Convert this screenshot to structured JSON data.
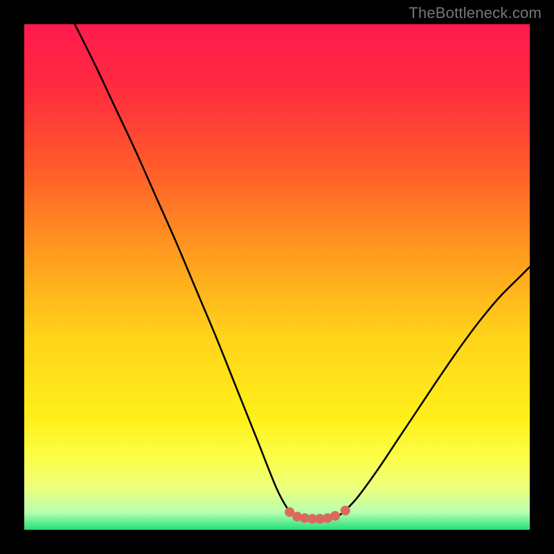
{
  "watermark": "TheBottleneck.com",
  "colors": {
    "frame": "#000000",
    "gradient_stops": [
      {
        "offset": 0.0,
        "color": "#ff1a4d"
      },
      {
        "offset": 0.12,
        "color": "#ff2a3f"
      },
      {
        "offset": 0.28,
        "color": "#ff5a2a"
      },
      {
        "offset": 0.45,
        "color": "#ff9a1f"
      },
      {
        "offset": 0.62,
        "color": "#ffd41a"
      },
      {
        "offset": 0.78,
        "color": "#fff019"
      },
      {
        "offset": 0.86,
        "color": "#fbff4a"
      },
      {
        "offset": 0.92,
        "color": "#eaff80"
      },
      {
        "offset": 0.965,
        "color": "#b9ffb0"
      },
      {
        "offset": 1.0,
        "color": "#22e07a"
      }
    ],
    "curve_stroke": "#000000",
    "marker_stroke": "#da6a5f",
    "marker_fill": "#da6a5f"
  },
  "chart_data": {
    "type": "line",
    "title": "",
    "xlabel": "",
    "ylabel": "",
    "xlim": [
      0,
      100
    ],
    "ylim": [
      0,
      100
    ],
    "grid": false,
    "series": [
      {
        "name": "left-branch",
        "x": [
          10,
          14,
          18,
          22,
          26,
          30,
          34,
          38,
          42,
          46,
          50,
          52.5
        ],
        "y": [
          100,
          92,
          83.5,
          75,
          66,
          57,
          47.5,
          38,
          28,
          18,
          8,
          3.5
        ]
      },
      {
        "name": "bottom-flat",
        "x": [
          52.5,
          54,
          56,
          58,
          60,
          62,
          63.5
        ],
        "y": [
          3.5,
          2.6,
          2.2,
          2.1,
          2.2,
          2.7,
          3.8
        ]
      },
      {
        "name": "right-branch",
        "x": [
          63.5,
          66,
          70,
          74,
          78,
          82,
          86,
          90,
          94,
          98,
          100
        ],
        "y": [
          3.8,
          6.5,
          12,
          18,
          24,
          30,
          35.8,
          41.2,
          46.0,
          50.0,
          52.0
        ]
      }
    ],
    "markers": {
      "name": "bottom-markers",
      "x": [
        52.5,
        54,
        55.5,
        57,
        58.5,
        60,
        61.5,
        63.5
      ],
      "y": [
        3.5,
        2.6,
        2.3,
        2.15,
        2.15,
        2.3,
        2.75,
        3.8
      ],
      "radius_px": 7
    }
  }
}
